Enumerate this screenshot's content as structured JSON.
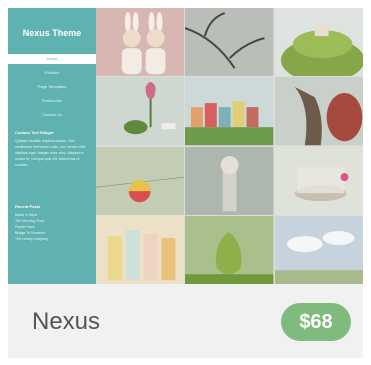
{
  "theme": {
    "name": "Nexus",
    "price": "$68",
    "sidebar_title": "Nexus Theme",
    "menu": [
      "Home",
      "Portfolio",
      "Page Templates",
      "Shortcodes",
      "Contact Us"
    ],
    "widget_title": "Custom Text Widget",
    "widget_text": "Quisque facilisis dapibus dictum. Sed vestibulum fermentum odio, non ornare velit dapibus eget. Integer dolor arcu. Aliquam a ornare id, volutpat quis elit. Maecenas ut sodales.",
    "recent_title": "Recent Posts",
    "recent_posts": [
      "Made in Wind",
      "The Morning Rose",
      "Purple Haze",
      "Bridge To Nowhere",
      "The Lonely Ladybug"
    ]
  },
  "colors": {
    "sidebar": "#5fb2b0",
    "price_badge": "#7fbb7c",
    "title": "#555555",
    "footer": "#f1f1f1"
  }
}
